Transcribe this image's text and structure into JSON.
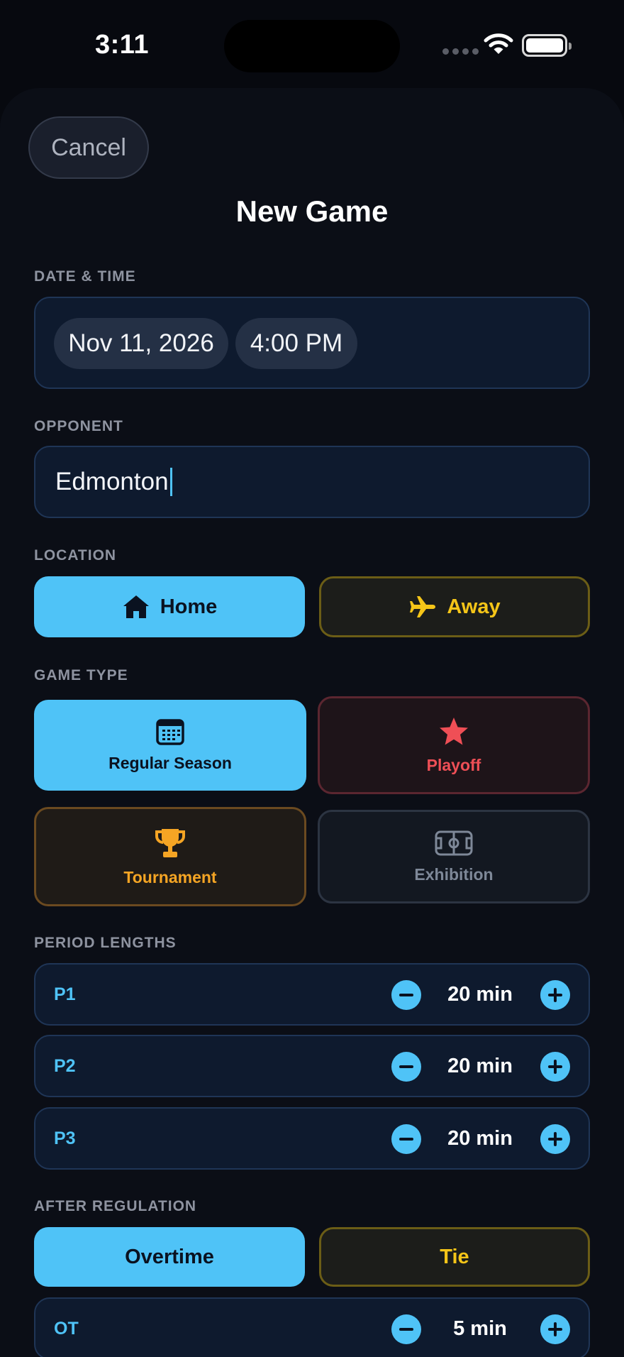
{
  "status": {
    "time": "3:11"
  },
  "header": {
    "cancel_label": "Cancel",
    "title": "New Game"
  },
  "datetime": {
    "label": "DATE & TIME",
    "date": "Nov 11, 2026",
    "time": "4:00 PM"
  },
  "opponent": {
    "label": "OPPONENT",
    "value": "Edmonton"
  },
  "location": {
    "label": "LOCATION",
    "options": [
      {
        "label": "Home",
        "icon": "house-icon",
        "selected": true
      },
      {
        "label": "Away",
        "icon": "airplane-icon",
        "selected": false
      }
    ]
  },
  "game_type": {
    "label": "GAME TYPE",
    "options": [
      {
        "label": "Regular Season",
        "icon": "calendar-icon",
        "selected": true
      },
      {
        "label": "Playoff",
        "icon": "star-icon",
        "selected": false
      },
      {
        "label": "Tournament",
        "icon": "trophy-icon",
        "selected": false
      },
      {
        "label": "Exhibition",
        "icon": "rink-icon",
        "selected": false
      }
    ]
  },
  "periods": {
    "label": "PERIOD LENGTHS",
    "items": [
      {
        "name": "P1",
        "value": "20 min"
      },
      {
        "name": "P2",
        "value": "20 min"
      },
      {
        "name": "P3",
        "value": "20 min"
      }
    ]
  },
  "after_regulation": {
    "label": "AFTER REGULATION",
    "options": [
      {
        "label": "Overtime",
        "selected": true
      },
      {
        "label": "Tie",
        "selected": false
      }
    ],
    "ot": {
      "name": "OT",
      "value": "5 min"
    }
  },
  "colors": {
    "accent": "#4fc3f7",
    "away": "#f5c518",
    "playoff": "#ef4f56",
    "tournament": "#f5a524",
    "exhibition": "#7e8898",
    "background": "#0b0e16"
  }
}
